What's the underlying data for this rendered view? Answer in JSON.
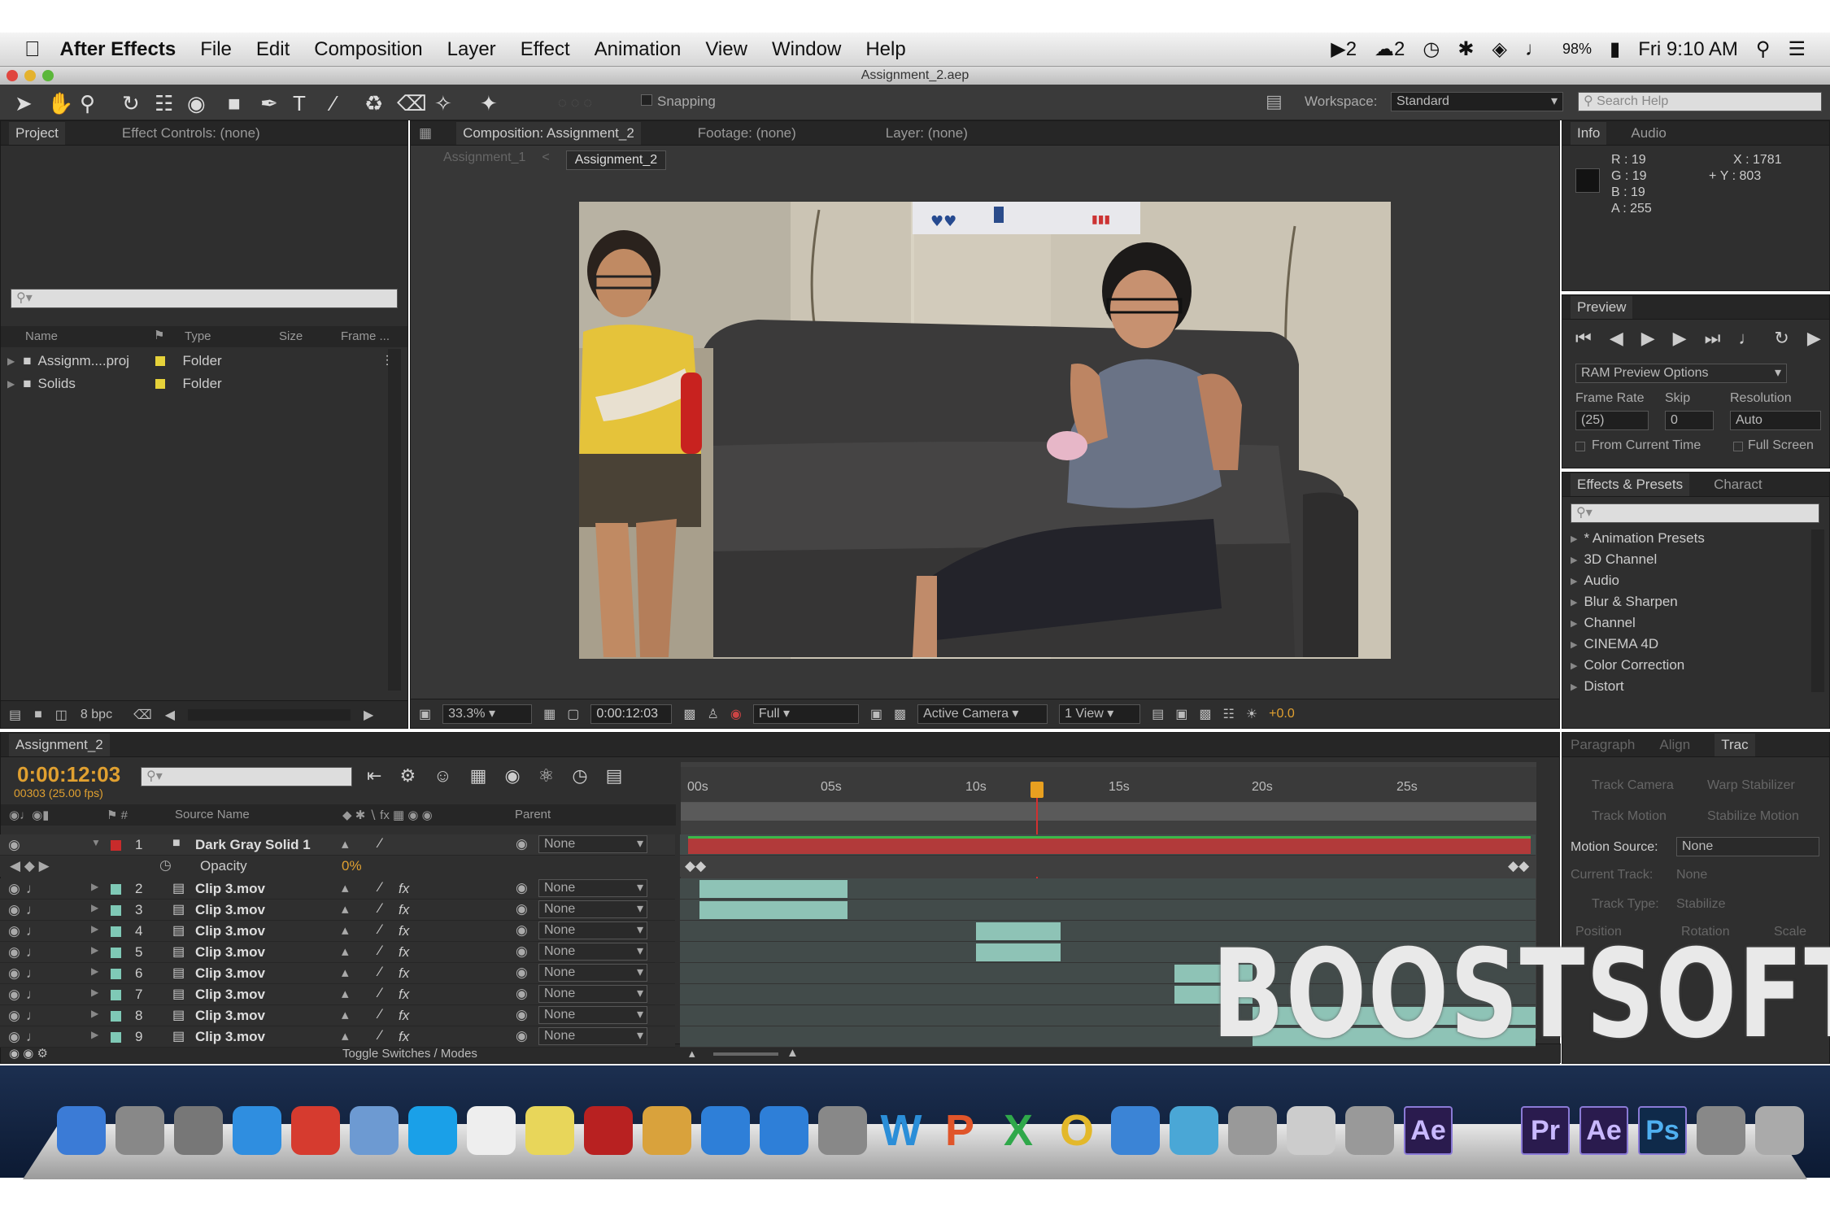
{
  "menubar": {
    "app": "After Effects",
    "items": [
      "File",
      "Edit",
      "Composition",
      "Layer",
      "Effect",
      "Animation",
      "View",
      "Window",
      "Help"
    ],
    "status": {
      "adobe": "2",
      "cloud": "2",
      "battery": "98%",
      "clock": "Fri 9:10 AM"
    }
  },
  "window": {
    "title": "Assignment_2.aep"
  },
  "toolbar": {
    "snapping": "Snapping",
    "workspace_label": "Workspace:",
    "workspace_value": "Standard",
    "search_placeholder": "Search Help"
  },
  "project": {
    "tabs": [
      "Project",
      "Effect Controls: (none)"
    ],
    "columns": [
      "Name",
      "Type",
      "Size",
      "Frame ..."
    ],
    "items": [
      {
        "name": "Assignm....proj",
        "type": "Folder"
      },
      {
        "name": "Solids",
        "type": "Folder"
      }
    ],
    "bpc": "8 bpc"
  },
  "composition": {
    "tabs": [
      "Composition: Assignment_2",
      "Footage: (none)",
      "Layer: (none)"
    ],
    "subtabs": [
      "Assignment_1",
      "Assignment_2"
    ],
    "zoom": "33.3%",
    "timecode": "0:00:12:03",
    "resolution": "Full",
    "camera": "Active Camera",
    "views": "1 View",
    "exposure": "+0.0"
  },
  "info": {
    "tabs": [
      "Info",
      "Audio"
    ],
    "r": "R : 19",
    "g": "G : 19",
    "b": "B : 19",
    "a": "A : 255",
    "x": "X : 1781",
    "y": "Y : 803"
  },
  "preview": {
    "tab": "Preview",
    "ram": "RAM Preview Options",
    "frame_rate_label": "Frame Rate",
    "skip_label": "Skip",
    "resolution_label": "Resolution",
    "frame_rate": "(25)",
    "skip": "0",
    "resolution": "Auto",
    "from_current": "From Current Time",
    "full_screen": "Full Screen"
  },
  "effects": {
    "tabs": [
      "Effects & Presets",
      "Charact"
    ],
    "items": [
      "* Animation Presets",
      "3D Channel",
      "Audio",
      "Blur & Sharpen",
      "Channel",
      "CINEMA 4D",
      "Color Correction",
      "Distort"
    ]
  },
  "tracker": {
    "tabs": [
      "Paragraph",
      "Align",
      "Trac"
    ],
    "buttons": [
      "Track Camera",
      "Warp Stabilizer",
      "Track Motion",
      "Stabilize Motion"
    ],
    "motion_source_label": "Motion Source:",
    "motion_source": "None",
    "current_track_label": "Current Track:",
    "current_track": "None",
    "track_type_label": "Track Type:",
    "track_type": "Stabilize",
    "options": [
      "Position",
      "Rotation",
      "Scale"
    ]
  },
  "timeline": {
    "tab": "Assignment_2",
    "timecode": "0:00:12:03",
    "frames": "00303 (25.00 fps)",
    "col_source": "Source Name",
    "col_parent": "Parent",
    "ruler": [
      "00s",
      "05s",
      "10s",
      "15s",
      "20s",
      "25s"
    ],
    "opacity_label": "Opacity",
    "opacity_value": "0%",
    "toggle": "Toggle Switches / Modes",
    "layers": [
      {
        "num": "1",
        "name": "Dark Gray Solid 1",
        "parent": "None"
      },
      {
        "num": "2",
        "name": "Clip 3.mov",
        "parent": "None"
      },
      {
        "num": "3",
        "name": "Clip 3.mov",
        "parent": "None"
      },
      {
        "num": "4",
        "name": "Clip 3.mov",
        "parent": "None"
      },
      {
        "num": "5",
        "name": "Clip 3.mov",
        "parent": "None"
      },
      {
        "num": "6",
        "name": "Clip 3.mov",
        "parent": "None"
      },
      {
        "num": "7",
        "name": "Clip 3.mov",
        "parent": "None"
      },
      {
        "num": "8",
        "name": "Clip 3.mov",
        "parent": "None"
      },
      {
        "num": "9",
        "name": "Clip 3.mov",
        "parent": "None"
      }
    ]
  },
  "watermark": "BOOSTSOFT",
  "dock": {
    "labels": [
      "Ae",
      "Pr",
      "Ae",
      "Ps",
      "W",
      "P",
      "X",
      "O"
    ]
  }
}
